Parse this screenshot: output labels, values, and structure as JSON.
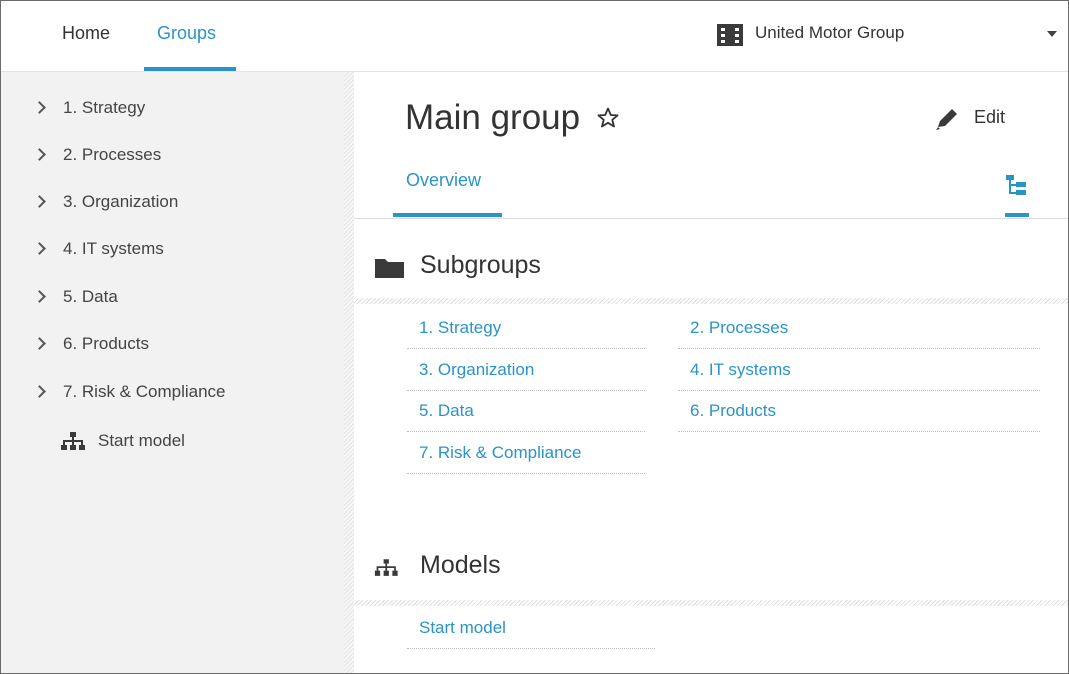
{
  "topbar": {
    "nav": [
      {
        "label": "Home",
        "active": false
      },
      {
        "label": "Groups",
        "active": true
      }
    ],
    "database": {
      "label": "United Motor Group",
      "icon": "database-icon"
    },
    "accent_color": "#2a94c7"
  },
  "sidebar": {
    "items": [
      {
        "label": "1. Strategy",
        "icon": "chevron-right-icon"
      },
      {
        "label": "2. Processes",
        "icon": "chevron-right-icon"
      },
      {
        "label": "3. Organization",
        "icon": "chevron-right-icon"
      },
      {
        "label": "4. IT systems",
        "icon": "chevron-right-icon"
      },
      {
        "label": "5. Data",
        "icon": "chevron-right-icon"
      },
      {
        "label": "6. Products",
        "icon": "chevron-right-icon"
      },
      {
        "label": "7. Risk & Compliance",
        "icon": "chevron-right-icon"
      }
    ],
    "model": {
      "label": "Start model",
      "icon": "model-hierarchy-icon"
    }
  },
  "main": {
    "title": "Main group",
    "edit_label": "Edit",
    "tabs": [
      {
        "label": "Overview",
        "active": true
      }
    ],
    "subgroups": {
      "title": "Subgroups",
      "icon": "folder-icon",
      "links": [
        "1. Strategy",
        "2. Processes",
        "3. Organization",
        "4. IT systems",
        "5. Data",
        "6. Products",
        "7. Risk & Compliance"
      ]
    },
    "models": {
      "title": "Models",
      "icon": "model-hierarchy-icon",
      "links": [
        "Start model"
      ]
    }
  }
}
